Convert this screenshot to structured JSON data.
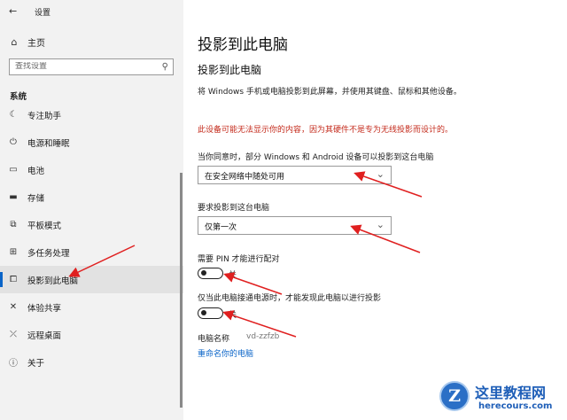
{
  "window": {
    "title": "设置",
    "back_icon": "back-arrow-icon"
  },
  "sidebar": {
    "home_label": "主页",
    "search_placeholder": "查找设置",
    "section_label": "系统",
    "items": [
      {
        "label": "专注助手",
        "icon": "moon-icon"
      },
      {
        "label": "电源和睡眠",
        "icon": "power-icon"
      },
      {
        "label": "电池",
        "icon": "battery-icon"
      },
      {
        "label": "存储",
        "icon": "storage-icon"
      },
      {
        "label": "平板模式",
        "icon": "tablet-mode-icon"
      },
      {
        "label": "多任务处理",
        "icon": "multitasking-icon"
      },
      {
        "label": "投影到此电脑",
        "icon": "projecting-icon",
        "active": true
      },
      {
        "label": "体验共享",
        "icon": "shared-experiences-icon"
      },
      {
        "label": "远程桌面",
        "icon": "remote-desktop-icon"
      },
      {
        "label": "关于",
        "icon": "info-icon"
      }
    ]
  },
  "main": {
    "title": "投影到此电脑",
    "subtitle": "投影到此电脑",
    "description": "将 Windows 手机或电脑投影到此屏幕，并使用其键盘、鼠标和其他设备。",
    "warning": "此设备可能无法显示你的内容，因为其硬件不是专为无线投影而设计的。",
    "availability_label": "当你同意时，部分 Windows 和 Android 设备可以投影到这台电脑",
    "availability_value": "在安全网络中随处可用",
    "ask_label": "要求投影到这台电脑",
    "ask_value": "仅第一次",
    "pin_label": "需要 PIN 才能进行配对",
    "pin_state": "关",
    "power_label": "仅当此电脑接通电源时，才能发现此电脑以进行投影",
    "power_state": "关",
    "pc_name_label": "电脑名称",
    "pc_name_value": "vd-zzfzb",
    "rename_link": "重命名你的电脑"
  },
  "watermark": {
    "logo_letter": "Z",
    "title": "这里教程网",
    "url": "herecours.com"
  },
  "colors": {
    "accent": "#0a64c8",
    "warning": "#c42b1c",
    "annotation_arrow": "#e02020",
    "watermark": "#1f5fb8"
  }
}
